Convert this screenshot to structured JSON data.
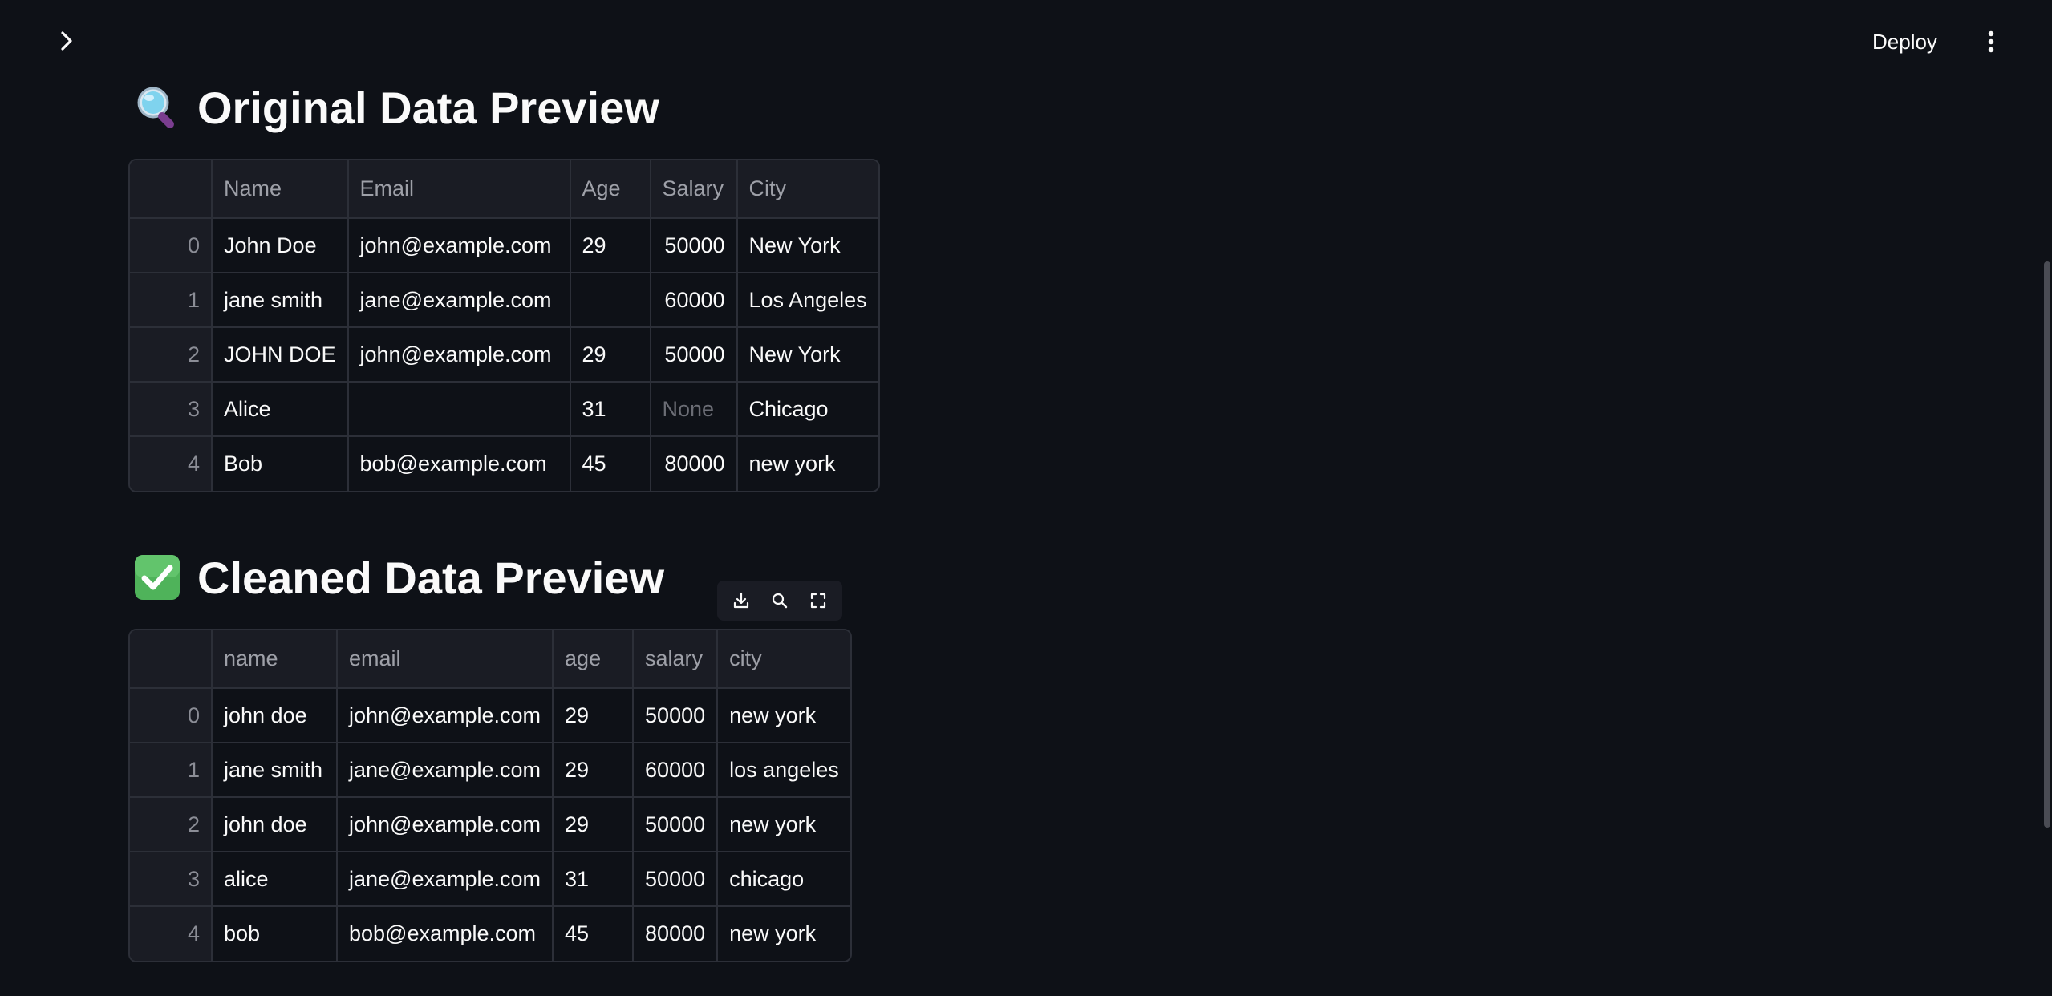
{
  "header": {
    "deploy_label": "Deploy"
  },
  "original": {
    "title": "Original Data Preview",
    "icon": "magnifier-emoji",
    "columns": [
      "",
      "Name",
      "Email",
      "Age",
      "Salary",
      "City"
    ],
    "rows": [
      {
        "index": "0",
        "name": "John Doe",
        "email": "john@example.com",
        "age": "29",
        "salary": "50000",
        "city": "New York"
      },
      {
        "index": "1",
        "name": "jane smith",
        "email": "jane@example.com",
        "age": "",
        "salary": "60000",
        "city": "Los Angeles"
      },
      {
        "index": "2",
        "name": "JOHN DOE",
        "email": "john@example.com",
        "age": "29",
        "salary": "50000",
        "city": "New York"
      },
      {
        "index": "3",
        "name": "Alice",
        "email": "",
        "age": "31",
        "salary": "None",
        "city": "Chicago"
      },
      {
        "index": "4",
        "name": "Bob",
        "email": "bob@example.com",
        "age": "45",
        "salary": "80000",
        "city": "new york"
      }
    ]
  },
  "cleaned": {
    "title": "Cleaned Data Preview",
    "icon": "check-mark-emoji",
    "columns": [
      "",
      "name",
      "email",
      "age",
      "salary",
      "city"
    ],
    "rows": [
      {
        "index": "0",
        "name": "john doe",
        "email": "john@example.com",
        "age": "29",
        "salary": "50000",
        "city": "new york"
      },
      {
        "index": "1",
        "name": "jane smith",
        "email": "jane@example.com",
        "age": "29",
        "salary": "60000",
        "city": "los angeles"
      },
      {
        "index": "2",
        "name": "john doe",
        "email": "john@example.com",
        "age": "29",
        "salary": "50000",
        "city": "new york"
      },
      {
        "index": "3",
        "name": "alice",
        "email": "jane@example.com",
        "age": "31",
        "salary": "50000",
        "city": "chicago"
      },
      {
        "index": "4",
        "name": "bob",
        "email": "bob@example.com",
        "age": "45",
        "salary": "80000",
        "city": "new york"
      }
    ]
  },
  "colors": {
    "background": "#0e1117",
    "text": "#fafafa",
    "border": "#2c2f38",
    "header_bg": "#1a1c24",
    "muted": "#9ea0a8",
    "success": "#3fb950"
  }
}
